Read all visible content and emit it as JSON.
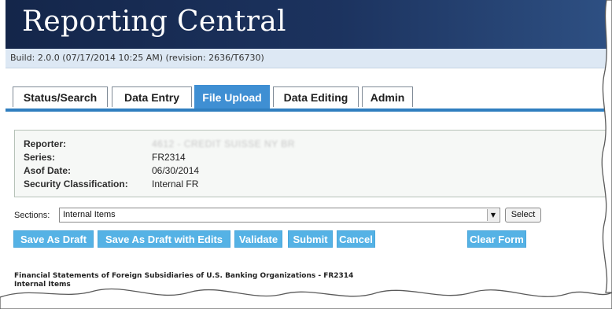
{
  "app": {
    "title": "Reporting Central",
    "build": "Build: 2.0.0 (07/17/2014 10:25 AM) (revision: 2636/T6730)"
  },
  "tabs": [
    {
      "label": "Status/Search",
      "active": false
    },
    {
      "label": "Data Entry",
      "active": false
    },
    {
      "label": "File Upload",
      "active": true
    },
    {
      "label": "Data Editing",
      "active": false
    },
    {
      "label": "Admin",
      "active": false
    }
  ],
  "info": {
    "reporter_label": "Reporter:",
    "reporter_value": "4612 - CREDIT SUISSE NY BR",
    "series_label": "Series:",
    "series_value": "FR2314",
    "asof_label": "Asof Date:",
    "asof_value": "06/30/2014",
    "security_label": "Security Classification:",
    "security_value": "Internal FR"
  },
  "sections": {
    "label": "Sections:",
    "selected": "Internal Items",
    "select_button": "Select"
  },
  "actions": {
    "save_draft": "Save As Draft",
    "save_draft_edits": "Save As Draft with Edits",
    "validate": "Validate",
    "submit": "Submit",
    "cancel": "Cancel",
    "clear_form": "Clear Form"
  },
  "form": {
    "title_line1": "Financial Statements of Foreign Subsidiaries of U.S. Banking Organizations - FR2314",
    "title_line2": "Internal Items"
  },
  "colors": {
    "header": "#1c335f",
    "tab_active": "#3f8fd3",
    "button": "#55b2e5"
  }
}
